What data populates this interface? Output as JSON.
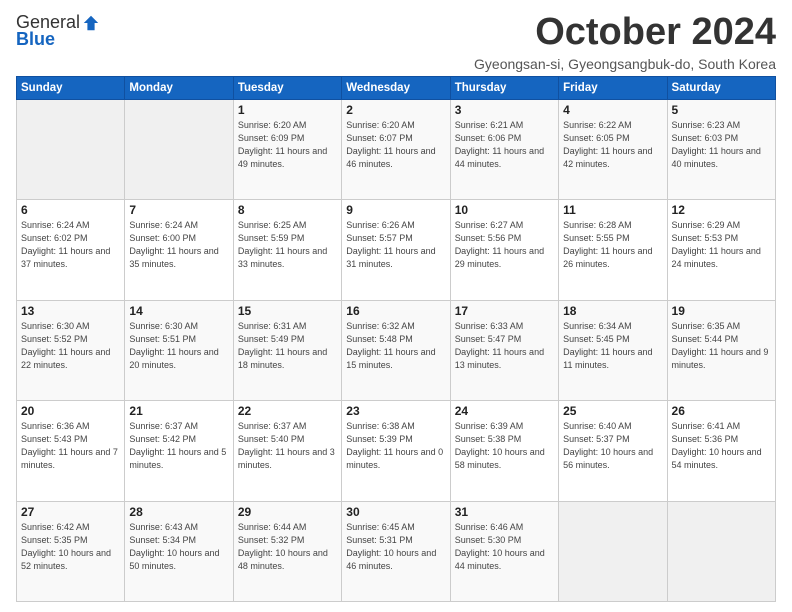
{
  "logo": {
    "general": "General",
    "blue": "Blue"
  },
  "header": {
    "month": "October 2024",
    "location": "Gyeongsan-si, Gyeongsangbuk-do, South Korea"
  },
  "days_of_week": [
    "Sunday",
    "Monday",
    "Tuesday",
    "Wednesday",
    "Thursday",
    "Friday",
    "Saturday"
  ],
  "weeks": [
    [
      {
        "day": "",
        "info": ""
      },
      {
        "day": "",
        "info": ""
      },
      {
        "day": "1",
        "info": "Sunrise: 6:20 AM\nSunset: 6:09 PM\nDaylight: 11 hours and 49 minutes."
      },
      {
        "day": "2",
        "info": "Sunrise: 6:20 AM\nSunset: 6:07 PM\nDaylight: 11 hours and 46 minutes."
      },
      {
        "day": "3",
        "info": "Sunrise: 6:21 AM\nSunset: 6:06 PM\nDaylight: 11 hours and 44 minutes."
      },
      {
        "day": "4",
        "info": "Sunrise: 6:22 AM\nSunset: 6:05 PM\nDaylight: 11 hours and 42 minutes."
      },
      {
        "day": "5",
        "info": "Sunrise: 6:23 AM\nSunset: 6:03 PM\nDaylight: 11 hours and 40 minutes."
      }
    ],
    [
      {
        "day": "6",
        "info": "Sunrise: 6:24 AM\nSunset: 6:02 PM\nDaylight: 11 hours and 37 minutes."
      },
      {
        "day": "7",
        "info": "Sunrise: 6:24 AM\nSunset: 6:00 PM\nDaylight: 11 hours and 35 minutes."
      },
      {
        "day": "8",
        "info": "Sunrise: 6:25 AM\nSunset: 5:59 PM\nDaylight: 11 hours and 33 minutes."
      },
      {
        "day": "9",
        "info": "Sunrise: 6:26 AM\nSunset: 5:57 PM\nDaylight: 11 hours and 31 minutes."
      },
      {
        "day": "10",
        "info": "Sunrise: 6:27 AM\nSunset: 5:56 PM\nDaylight: 11 hours and 29 minutes."
      },
      {
        "day": "11",
        "info": "Sunrise: 6:28 AM\nSunset: 5:55 PM\nDaylight: 11 hours and 26 minutes."
      },
      {
        "day": "12",
        "info": "Sunrise: 6:29 AM\nSunset: 5:53 PM\nDaylight: 11 hours and 24 minutes."
      }
    ],
    [
      {
        "day": "13",
        "info": "Sunrise: 6:30 AM\nSunset: 5:52 PM\nDaylight: 11 hours and 22 minutes."
      },
      {
        "day": "14",
        "info": "Sunrise: 6:30 AM\nSunset: 5:51 PM\nDaylight: 11 hours and 20 minutes."
      },
      {
        "day": "15",
        "info": "Sunrise: 6:31 AM\nSunset: 5:49 PM\nDaylight: 11 hours and 18 minutes."
      },
      {
        "day": "16",
        "info": "Sunrise: 6:32 AM\nSunset: 5:48 PM\nDaylight: 11 hours and 15 minutes."
      },
      {
        "day": "17",
        "info": "Sunrise: 6:33 AM\nSunset: 5:47 PM\nDaylight: 11 hours and 13 minutes."
      },
      {
        "day": "18",
        "info": "Sunrise: 6:34 AM\nSunset: 5:45 PM\nDaylight: 11 hours and 11 minutes."
      },
      {
        "day": "19",
        "info": "Sunrise: 6:35 AM\nSunset: 5:44 PM\nDaylight: 11 hours and 9 minutes."
      }
    ],
    [
      {
        "day": "20",
        "info": "Sunrise: 6:36 AM\nSunset: 5:43 PM\nDaylight: 11 hours and 7 minutes."
      },
      {
        "day": "21",
        "info": "Sunrise: 6:37 AM\nSunset: 5:42 PM\nDaylight: 11 hours and 5 minutes."
      },
      {
        "day": "22",
        "info": "Sunrise: 6:37 AM\nSunset: 5:40 PM\nDaylight: 11 hours and 3 minutes."
      },
      {
        "day": "23",
        "info": "Sunrise: 6:38 AM\nSunset: 5:39 PM\nDaylight: 11 hours and 0 minutes."
      },
      {
        "day": "24",
        "info": "Sunrise: 6:39 AM\nSunset: 5:38 PM\nDaylight: 10 hours and 58 minutes."
      },
      {
        "day": "25",
        "info": "Sunrise: 6:40 AM\nSunset: 5:37 PM\nDaylight: 10 hours and 56 minutes."
      },
      {
        "day": "26",
        "info": "Sunrise: 6:41 AM\nSunset: 5:36 PM\nDaylight: 10 hours and 54 minutes."
      }
    ],
    [
      {
        "day": "27",
        "info": "Sunrise: 6:42 AM\nSunset: 5:35 PM\nDaylight: 10 hours and 52 minutes."
      },
      {
        "day": "28",
        "info": "Sunrise: 6:43 AM\nSunset: 5:34 PM\nDaylight: 10 hours and 50 minutes."
      },
      {
        "day": "29",
        "info": "Sunrise: 6:44 AM\nSunset: 5:32 PM\nDaylight: 10 hours and 48 minutes."
      },
      {
        "day": "30",
        "info": "Sunrise: 6:45 AM\nSunset: 5:31 PM\nDaylight: 10 hours and 46 minutes."
      },
      {
        "day": "31",
        "info": "Sunrise: 6:46 AM\nSunset: 5:30 PM\nDaylight: 10 hours and 44 minutes."
      },
      {
        "day": "",
        "info": ""
      },
      {
        "day": "",
        "info": ""
      }
    ]
  ]
}
